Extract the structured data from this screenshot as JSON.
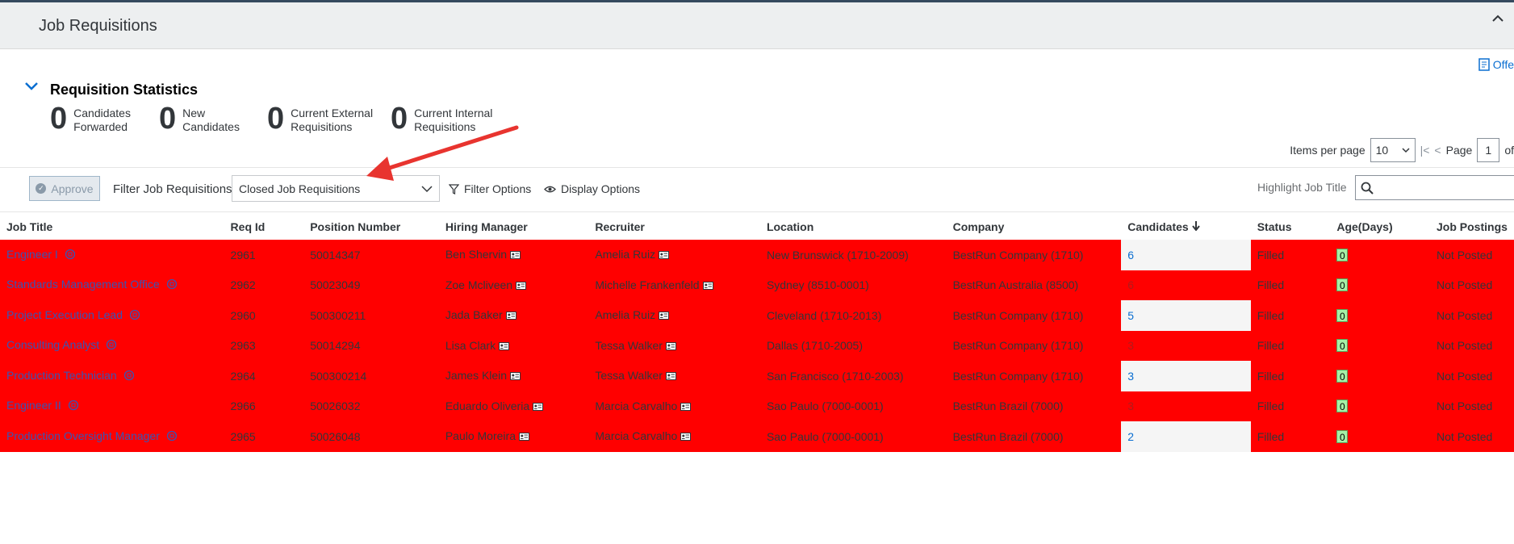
{
  "header": {
    "title": "Job Requisitions"
  },
  "offer_link": "Offe",
  "stats": {
    "title": "Requisition Statistics",
    "items": [
      {
        "value": "0",
        "line1": "Candidates",
        "line2": "Forwarded"
      },
      {
        "value": "0",
        "line1": "New",
        "line2": "Candidates"
      },
      {
        "value": "0",
        "line1": "Current External",
        "line2": "Requisitions"
      },
      {
        "value": "0",
        "line1": "Current Internal",
        "line2": "Requisitions"
      }
    ]
  },
  "pager": {
    "items_label": "Items per page",
    "items_value": "10",
    "page_label": "Page",
    "page_value": "1",
    "of_label": "of"
  },
  "toolbar": {
    "approve": "Approve",
    "filter_label": "Filter Job Requisitions",
    "filter_value": "Closed Job Requisitions",
    "filter_options": "Filter Options",
    "display_options": "Display Options",
    "highlight_label": "Highlight Job Title"
  },
  "table": {
    "headers": [
      "Job Title",
      "Req Id",
      "Position Number",
      "Hiring Manager",
      "Recruiter",
      "Location",
      "Company",
      "Candidates",
      "Status",
      "Age(Days)",
      "Job Postings"
    ],
    "rows": [
      {
        "title": "Engineer I",
        "req": "2961",
        "pos": "50014347",
        "hm": "Ben Shervin",
        "rec": "Amelia Ruiz",
        "loc": "New Brunswick (1710-2009)",
        "comp": "BestRun Company (1710)",
        "cand": "6",
        "status": "Filled",
        "age": "0",
        "post": "Not Posted"
      },
      {
        "title": "Standards Management Office",
        "req": "2962",
        "pos": "50023049",
        "hm": "Zoe Mcliveen",
        "rec": "Michelle Frankenfeld",
        "loc": "Sydney (8510-0001)",
        "comp": "BestRun Australia (8500)",
        "cand": "6",
        "status": "Filled",
        "age": "0",
        "post": "Not Posted"
      },
      {
        "title": "Project Execution Lead",
        "req": "2960",
        "pos": "500300211",
        "hm": "Jada Baker",
        "rec": "Amelia Ruiz",
        "loc": "Cleveland (1710-2013)",
        "comp": "BestRun Company (1710)",
        "cand": "5",
        "status": "Filled",
        "age": "0",
        "post": "Not Posted"
      },
      {
        "title": "Consulting Analyst",
        "req": "2963",
        "pos": "50014294",
        "hm": "Lisa Clark",
        "rec": "Tessa Walker",
        "loc": "Dallas (1710-2005)",
        "comp": "BestRun Company (1710)",
        "cand": "3",
        "status": "Filled",
        "age": "0",
        "post": "Not Posted"
      },
      {
        "title": "Production Technician",
        "req": "2964",
        "pos": "500300214",
        "hm": "James Klein",
        "rec": "Tessa Walker",
        "loc": "San Francisco (1710-2003)",
        "comp": "BestRun Company (1710)",
        "cand": "3",
        "status": "Filled",
        "age": "0",
        "post": "Not Posted"
      },
      {
        "title": "Engineer II",
        "req": "2966",
        "pos": "50026032",
        "hm": "Eduardo Oliveria",
        "rec": "Marcia Carvalho",
        "loc": "Sao Paulo (7000-0001)",
        "comp": "BestRun Brazil (7000)",
        "cand": "3",
        "status": "Filled",
        "age": "0",
        "post": "Not Posted"
      },
      {
        "title": "Production Oversight Manager",
        "req": "2965",
        "pos": "50026048",
        "hm": "Paulo Moreira",
        "rec": "Marcia Carvalho",
        "loc": "Sao Paulo (7000-0001)",
        "comp": "BestRun Brazil (7000)",
        "cand": "2",
        "status": "Filled",
        "age": "0",
        "post": "Not Posted"
      }
    ]
  },
  "colors": {
    "row_highlight": "#ff0000",
    "link": "#0a6ed1",
    "arrow": "#e8342f"
  }
}
